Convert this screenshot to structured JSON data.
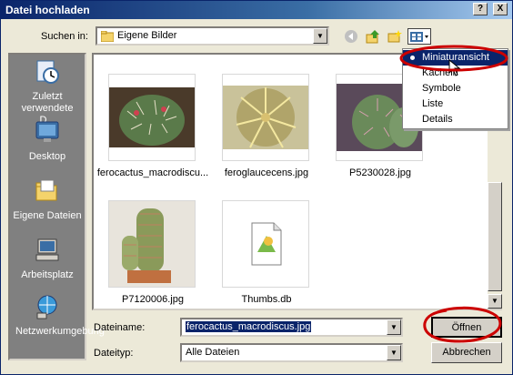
{
  "window": {
    "title": "Datei hochladen",
    "help_label": "?",
    "close_label": "X"
  },
  "lookin": {
    "label": "Suchen in:",
    "value": "Eigene Bilder"
  },
  "places": [
    {
      "label": "Zuletzt verwendete D..."
    },
    {
      "label": "Desktop"
    },
    {
      "label": "Eigene Dateien"
    },
    {
      "label": "Arbeitsplatz"
    },
    {
      "label": "Netzwerkumgebung"
    }
  ],
  "files": [
    {
      "name": "ferocactus_macrodiscu..."
    },
    {
      "name": "feroglaucecens.jpg"
    },
    {
      "name": "P5230028.jpg"
    },
    {
      "name": "P7120006.jpg"
    },
    {
      "name": "Thumbs.db"
    }
  ],
  "view_menu": {
    "items": [
      "Miniaturansicht",
      "Kacheln",
      "Symbole",
      "Liste",
      "Details"
    ],
    "selected_index": 0
  },
  "filename": {
    "label": "Dateiname:",
    "value": "ferocactus_macrodiscus.jpg"
  },
  "filetype": {
    "label": "Dateityp:",
    "value": "Alle Dateien"
  },
  "buttons": {
    "open": "Öffnen",
    "cancel": "Abbrechen"
  },
  "colors": {
    "title_bar": "#0a246a",
    "selection": "#0a246a",
    "annotation": "#cc0000"
  }
}
